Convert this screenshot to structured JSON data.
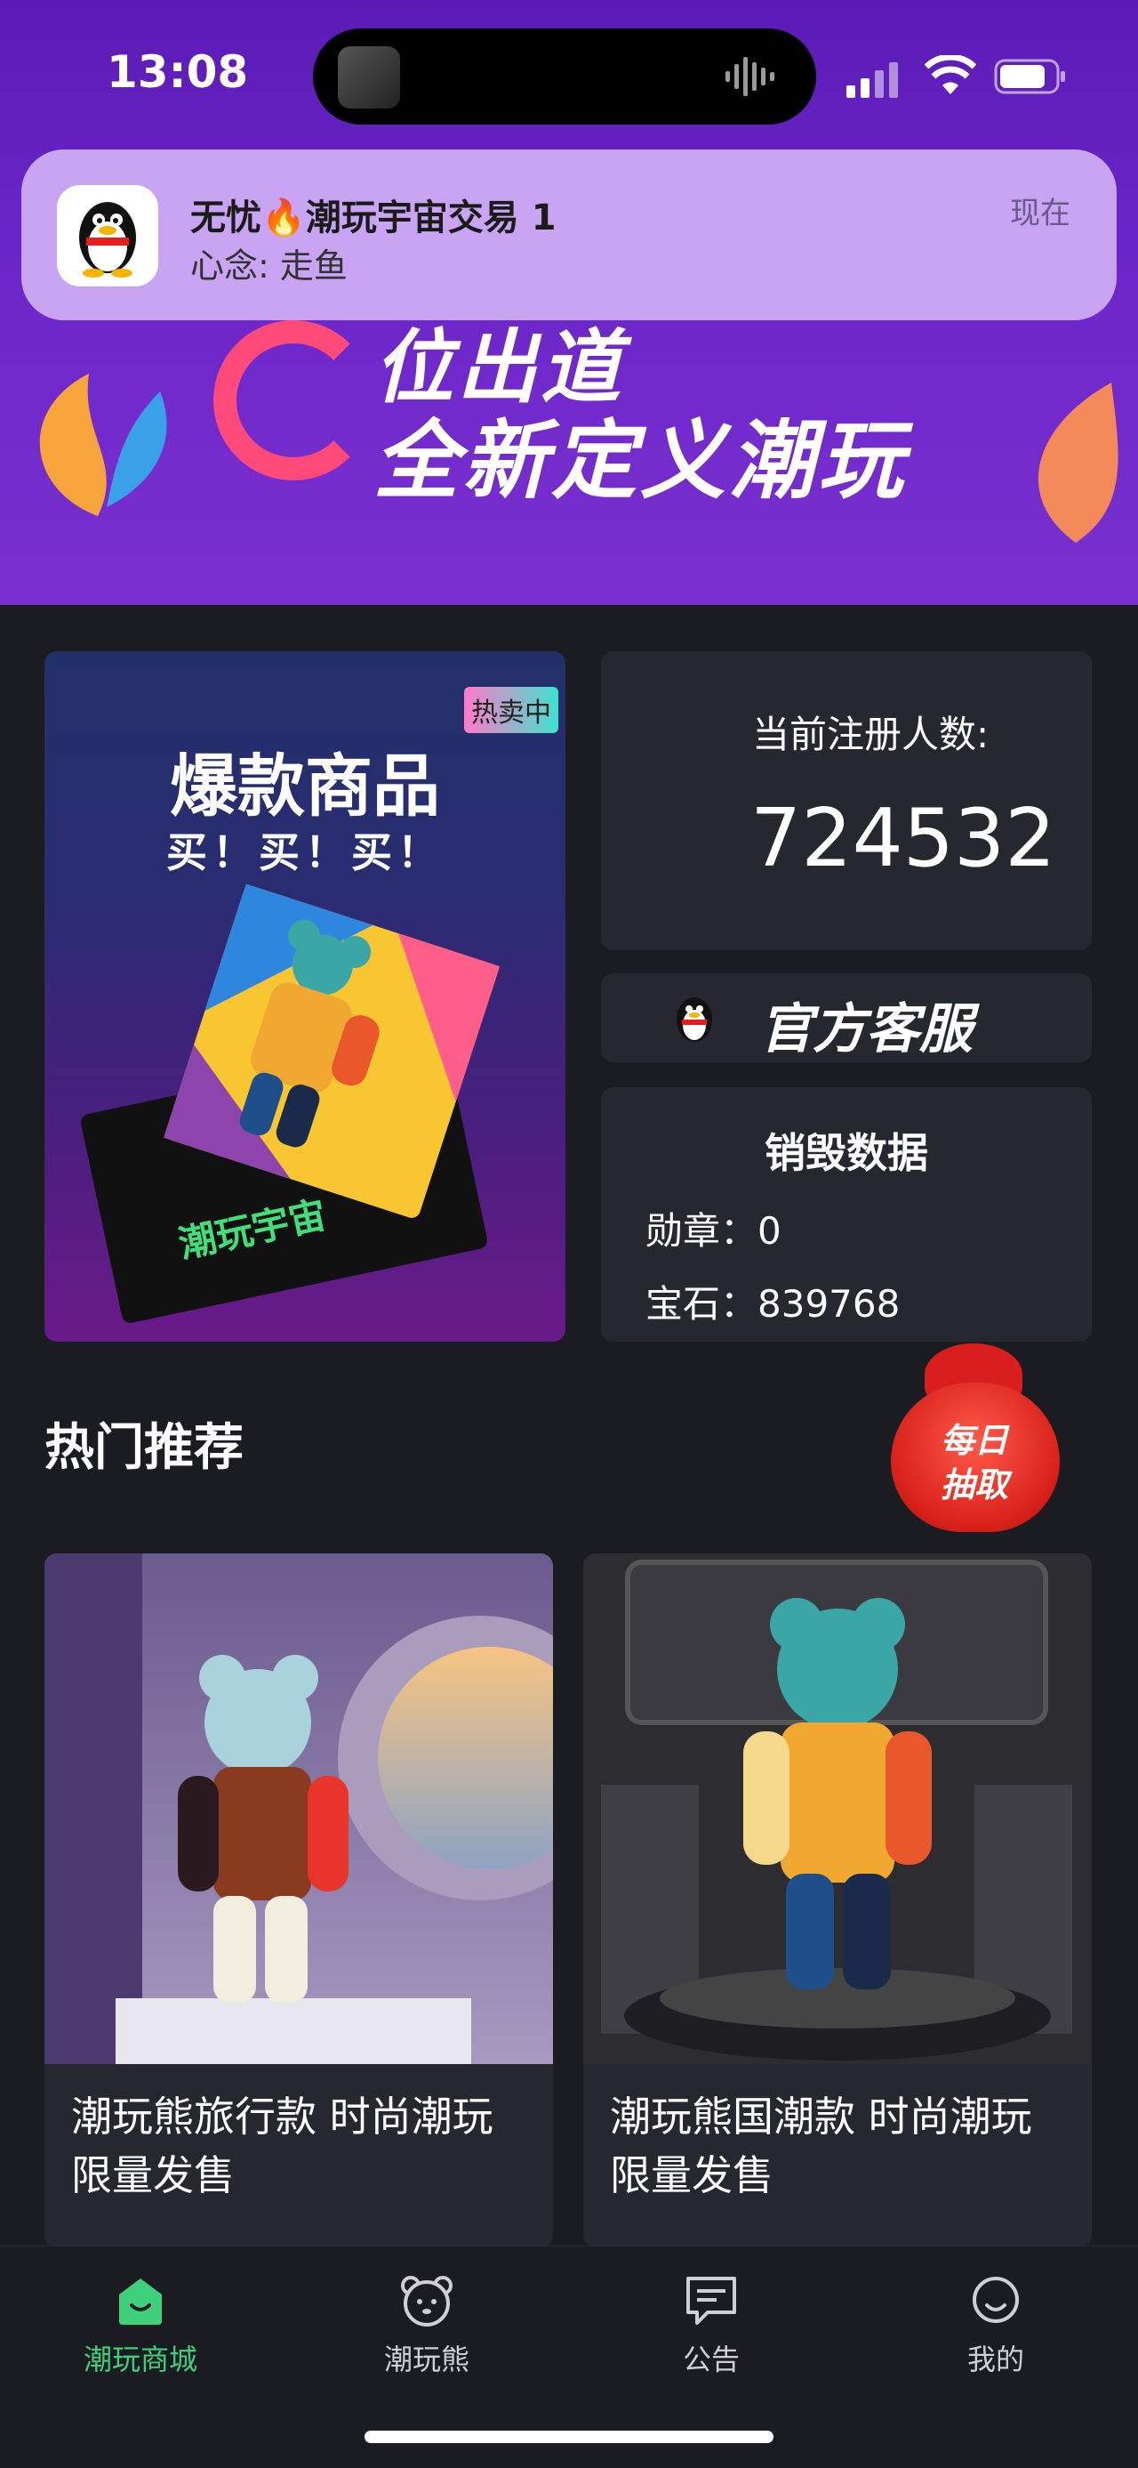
{
  "status_bar": {
    "time": "13:08"
  },
  "notification": {
    "app_icon": "qq-penguin-icon",
    "title": "无忧🔥潮玩宇宙交易 1",
    "body": "心念: 走鱼",
    "time": "现在"
  },
  "banner": {
    "line1": "位出道",
    "line2": "全新定义潮玩"
  },
  "promo_card": {
    "tag": "热卖中",
    "headline": "爆款商品",
    "subline": "买！买！买！",
    "pack_label": "潮玩宇宙"
  },
  "stats": {
    "registered_label": "当前注册人数:",
    "registered_count": "724532"
  },
  "service": {
    "label": "官方客服"
  },
  "burn_data": {
    "title": "销毁数据",
    "medal_label": "勋章：",
    "medal_value": "0",
    "gem_label": "宝石：",
    "gem_value": "839768"
  },
  "section": {
    "title": "热门推荐",
    "lottery_label_1": "每日",
    "lottery_label_2": "抽取"
  },
  "products": [
    {
      "name": "潮玩熊旅行款 时尚潮玩 限量发售"
    },
    {
      "name": "潮玩熊国潮款 时尚潮玩 限量发售"
    }
  ],
  "tabbar": {
    "items": [
      {
        "label": "潮玩商城",
        "icon": "store-icon",
        "active": true
      },
      {
        "label": "潮玩熊",
        "icon": "bear-icon",
        "active": false
      },
      {
        "label": "公告",
        "icon": "message-icon",
        "active": false
      },
      {
        "label": "我的",
        "icon": "smiley-icon",
        "active": false
      }
    ]
  },
  "colors": {
    "accent": "#3fd07b",
    "background": "#1b1c22",
    "card": "#262830",
    "header_purple": "#6a25c8"
  }
}
